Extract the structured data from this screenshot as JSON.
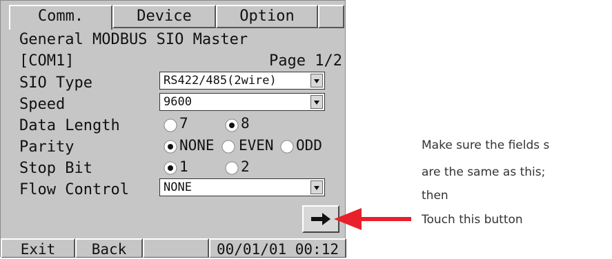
{
  "tabs": [
    "Comm.",
    "Device",
    "Option",
    ""
  ],
  "header": {
    "title": "General MODBUS SIO Master",
    "port": "[COM1]",
    "page": "Page 1/2"
  },
  "fields": {
    "sio_type": {
      "label": "SIO Type",
      "value": "RS422/485(2wire)"
    },
    "speed": {
      "label": "Speed",
      "value": "9600"
    },
    "data_length": {
      "label": "Data Length",
      "options": [
        "7",
        "8"
      ],
      "selected": "8"
    },
    "parity": {
      "label": "Parity",
      "options": [
        "NONE",
        "EVEN",
        "ODD"
      ],
      "selected": "NONE"
    },
    "stop_bit": {
      "label": "Stop Bit",
      "options": [
        "1",
        "2"
      ],
      "selected": "1"
    },
    "flow_control": {
      "label": "Flow Control",
      "value": "NONE"
    }
  },
  "icons": {
    "next": "right-arrow-icon",
    "dropdown": "chevron-down-icon"
  },
  "bottom_bar": {
    "exit": "Exit",
    "back": "Back",
    "blank": "",
    "datetime": "00/01/01 00:12"
  },
  "annotation": {
    "line1": "Make sure the fields s",
    "line2": "are the same as this;",
    "line3": "then",
    "line4": "Touch this button"
  },
  "colors": {
    "panel": "#c6c6c6",
    "callout_arrow": "#e8202a"
  }
}
